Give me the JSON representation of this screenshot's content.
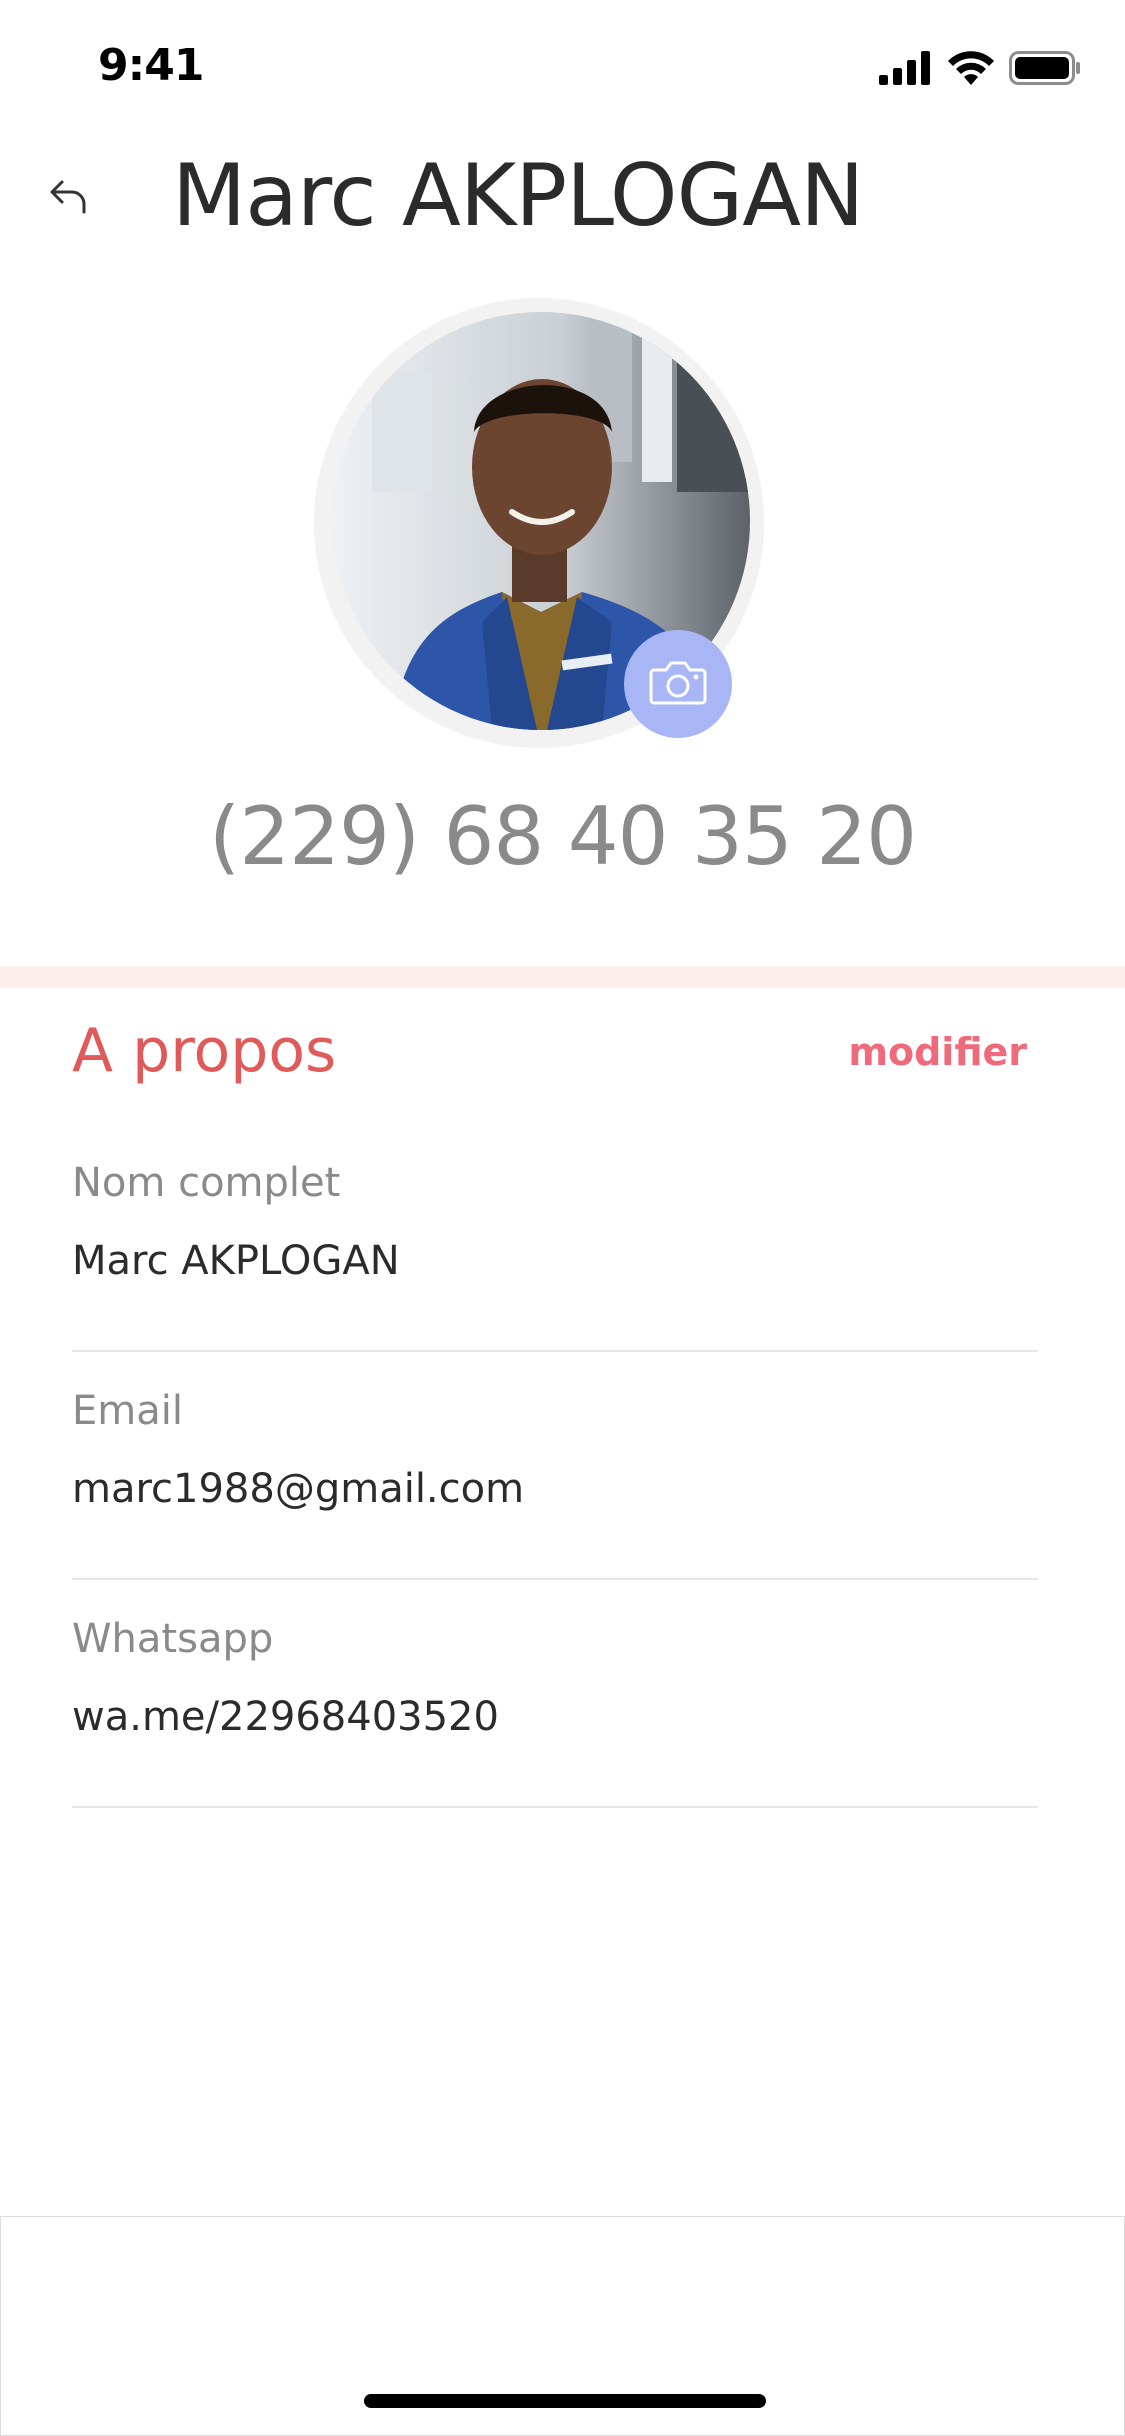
{
  "status_bar": {
    "time": "9:41",
    "icons": [
      "signal-icon",
      "wifi-icon",
      "battery-icon"
    ]
  },
  "header": {
    "back_icon": "back-arrow-icon",
    "title": "Marc AKPLOGAN"
  },
  "profile": {
    "avatar_description": "profile photo",
    "camera_icon": "camera-icon",
    "phone": "(229) 68 40 35 20"
  },
  "about": {
    "title": "A propos",
    "edit_label": "modifier",
    "fields": [
      {
        "label": "Nom complet",
        "value": "Marc AKPLOGAN"
      },
      {
        "label": "Email",
        "value": "marc1988@gmail.com"
      },
      {
        "label": "Whatsapp",
        "value": "wa.me/22968403520"
      }
    ]
  },
  "colors": {
    "accent": "#e05a5a",
    "link": "#ef6a7a",
    "camera_button": "#a8b6f5",
    "divider_band": "#fdeeee"
  }
}
